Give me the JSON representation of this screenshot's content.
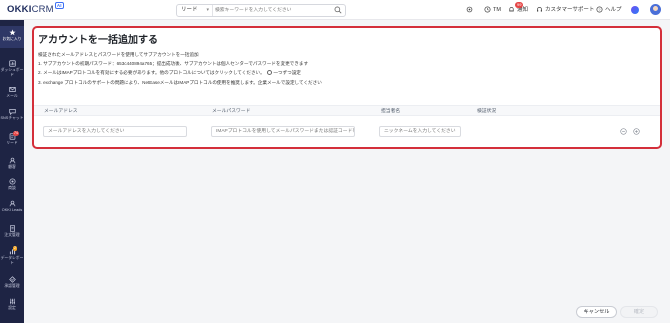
{
  "app": {
    "logo_text": "OKKI",
    "logo_suffix": "CRM",
    "logo_badge": "AI"
  },
  "search": {
    "type_label": "リード",
    "placeholder": "検索キーワードを入力してください"
  },
  "header": {
    "user_label": "TM",
    "notice_label": "通知",
    "notice_count": "99",
    "support_label": "カスタマーサポート",
    "help_label": "ヘルプ"
  },
  "sidebar": {
    "items": [
      {
        "label": "お気に入り",
        "icon": "star-icon"
      },
      {
        "label": "ダッシュボード",
        "icon": "dashboard-icon"
      },
      {
        "label": "メール",
        "icon": "mail-icon"
      },
      {
        "label": "SNSチャット",
        "icon": "chat-icon"
      },
      {
        "label": "リード",
        "icon": "lead-icon",
        "badge": "74"
      },
      {
        "label": "顧客",
        "icon": "customer-icon"
      },
      {
        "label": "商談",
        "icon": "deal-icon"
      },
      {
        "label": "OKKI Leads",
        "icon": "leads-icon"
      },
      {
        "label": "注文管理",
        "icon": "order-icon"
      },
      {
        "label": "データレポート",
        "icon": "report-icon",
        "badge": "2"
      },
      {
        "label": "承認管理",
        "icon": "approval-icon"
      },
      {
        "label": "設定",
        "icon": "settings-icon"
      }
    ]
  },
  "main": {
    "title": "アカウントを一括追加する",
    "desc_lines": [
      "検証されたメールアドレスとパスワードを使用してサブアカウントを一括追加",
      "1. サブアカウントの初期パスワード：653c440894a765；提出成功後、サブアカウントは個人センターでパスワードを変更できます",
      "2. メールはIMAPプロトコルを有効にする必要があります。他のプロトコルについてはクリックしてください。",
      "3. exchange プロトコルのサポートの問題により、NetEaseメールはIMAPプロトコルの使用を推奨します。企業メールで設定してください"
    ],
    "desc_line2_link": "一つずつ設定",
    "columns": [
      "メールアドレス",
      "メールパスワード",
      "担当者名",
      "検証状況"
    ],
    "row": {
      "email_placeholder": "メールアドレスを入力してください",
      "password_placeholder": "IMAPプロトコルを使用してメールパスワードまたは認証コードを入力してください",
      "nickname_placeholder": "ニックネームを入力してください"
    }
  },
  "footer": {
    "cancel_label": "キャンセル",
    "confirm_label": "確定"
  },
  "colors": {
    "sidebar_bg": "#1e2444",
    "highlight_border": "#d42f3a",
    "accent": "#3b6ff5"
  }
}
